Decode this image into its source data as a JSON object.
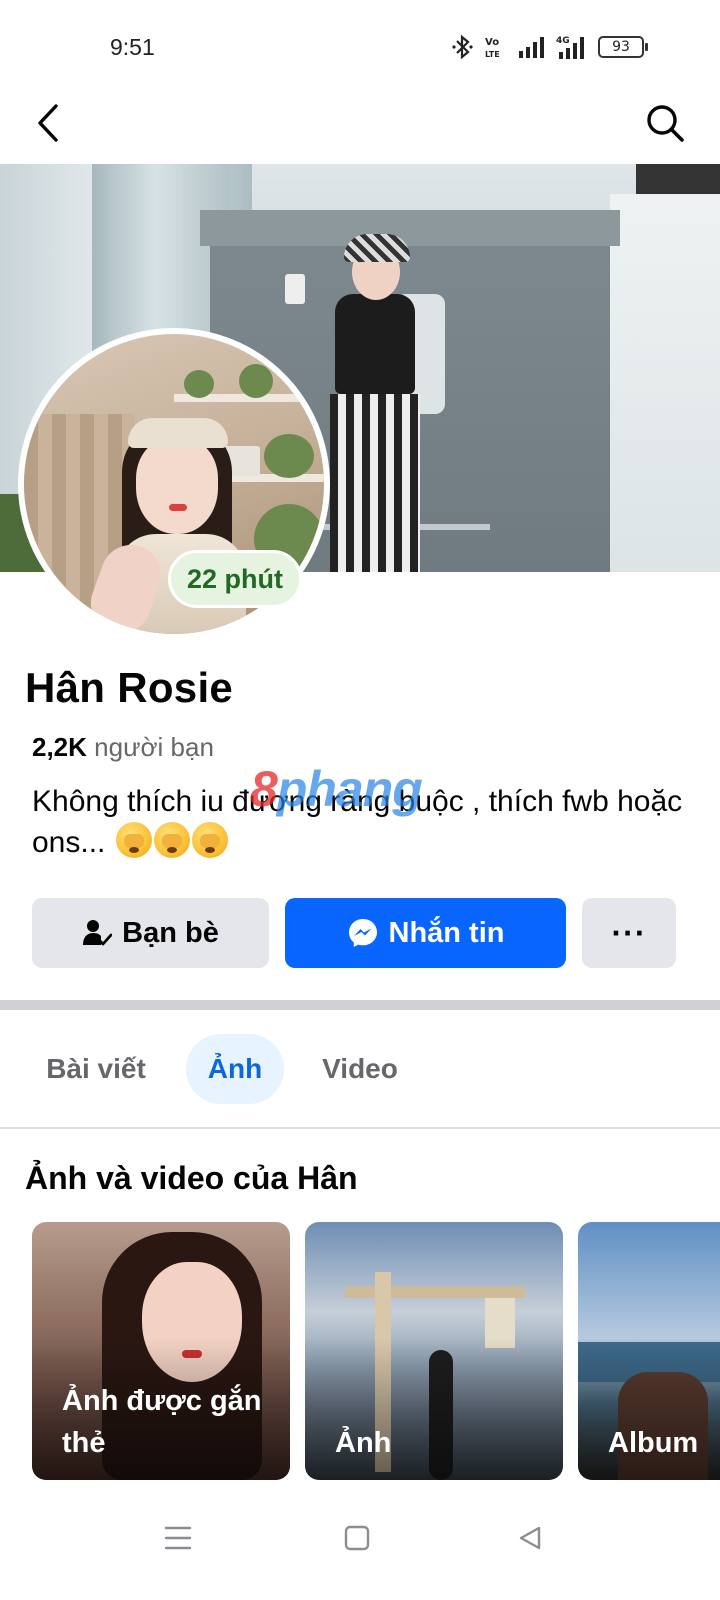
{
  "status_bar": {
    "time": "9:51",
    "battery": "93",
    "icons": [
      "bluetooth-icon",
      "volte-icon",
      "signal-icon",
      "4g-signal-icon",
      "battery-icon"
    ]
  },
  "nav": {
    "back_icon": "chevron-left-icon",
    "search_icon": "search-icon"
  },
  "profile": {
    "active_badge": "22 phút",
    "name": "Hân Rosie",
    "friends_count": "2,2K",
    "friends_label": "người bạn",
    "bio": "Không thích iu đương ràng buộc , thích fwb hoặc ons...",
    "bio_emojis": [
      "face-with-hand-over-eyes",
      "face-with-hand-over-eyes",
      "face-with-hand-over-eyes"
    ]
  },
  "watermark": {
    "part1": "8",
    "part2": "phang"
  },
  "actions": {
    "friends_label": "Bạn bè",
    "message_label": "Nhắn tin",
    "more_label": "···"
  },
  "tabs": [
    {
      "label": "Bài viết",
      "active": false
    },
    {
      "label": "Ảnh",
      "active": true
    },
    {
      "label": "Video",
      "active": false
    }
  ],
  "photos_section": {
    "title": "Ảnh và video của Hân",
    "cards": [
      {
        "label": "Ảnh được gắn thẻ"
      },
      {
        "label": "Ảnh"
      },
      {
        "label": "Album"
      }
    ]
  },
  "colors": {
    "accent": "#0866ff",
    "active_tab_bg": "#e7f3ff",
    "active_tab_text": "#0a67dd",
    "badge_bg": "#e7f3e1",
    "badge_text": "#206a24",
    "button_gray": "#e4e6eb"
  }
}
